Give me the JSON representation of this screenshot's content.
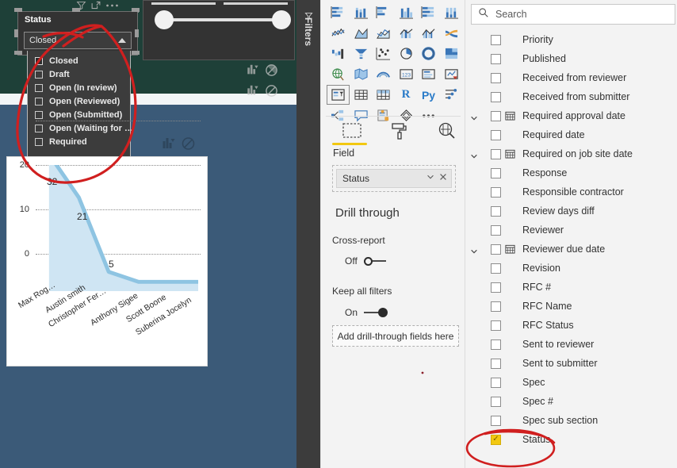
{
  "canvas": {
    "slicer": {
      "title": "Status",
      "selected_value": "Closed",
      "chevron_icon": "chevron-up-icon",
      "items": [
        {
          "label": "Closed",
          "checked": true
        },
        {
          "label": "Draft",
          "checked": false
        },
        {
          "label": "Open (In review)",
          "checked": false
        },
        {
          "label": "Open (Reviewed)",
          "checked": false
        },
        {
          "label": "Open (Submitted)",
          "checked": false
        },
        {
          "label": "Open (Waiting for …",
          "checked": false
        },
        {
          "label": "Required",
          "checked": false
        }
      ]
    },
    "range_slicer": {
      "left_knob_label": "",
      "right_knob_label": ""
    },
    "visual_header_icons": [
      "filter-icon",
      "focus-mode-icon",
      "more-options-icon"
    ],
    "visual_corner_icons": [
      "drill-down-icon",
      "no-entry-icon"
    ]
  },
  "chart_data": {
    "type": "area",
    "title": "",
    "xlabel": "",
    "ylabel": "",
    "categories": [
      "Max Rog…",
      "Austin smith",
      "Christopher Fer…",
      "Anthony Sigee",
      "Scott Boone",
      "Suberina Jocelyn"
    ],
    "values": [
      32,
      21,
      5,
      1,
      1,
      1
    ],
    "data_labels": [
      "32",
      "21",
      "5",
      "",
      "",
      ""
    ],
    "ylim": [
      0,
      30
    ],
    "yticks": [
      "0",
      "10",
      "20"
    ],
    "grid": true,
    "legend": "none",
    "series_color": "#8ec4e2",
    "fill_color": "#cfe5f3"
  },
  "viz_pane": {
    "filters_tab_label": "Filters",
    "filters_tab_icon": "filter-arrow-icon",
    "gallery_icons": [
      "stacked-bar-chart-icon",
      "stacked-column-chart-icon",
      "clustered-bar-chart-icon",
      "clustered-column-chart-icon",
      "100-stacked-bar-chart-icon",
      "100-stacked-column-chart-icon",
      "line-chart-icon",
      "area-chart-icon",
      "stacked-area-chart-icon",
      "line-stacked-column-chart-icon",
      "line-clustered-column-chart-icon",
      "ribbon-chart-icon",
      "waterfall-chart-icon",
      "funnel-chart-icon",
      "scatter-chart-icon",
      "pie-chart-icon",
      "donut-chart-icon",
      "treemap-icon",
      "map-icon",
      "filled-map-icon",
      "arcgis-map-icon",
      "card-icon",
      "multi-row-card-icon",
      "kpi-icon",
      "slicer-icon",
      "table-icon",
      "matrix-icon",
      "r-script-visual-icon",
      "python-visual-icon",
      "key-influencers-icon",
      "decomposition-tree-icon",
      "qa-visual-icon",
      "paginated-report-icon",
      "power-apps-icon",
      "more-visuals-icon"
    ],
    "tabs": [
      {
        "name": "fields-tab",
        "icon": "fields-icon",
        "active": true
      },
      {
        "name": "format-tab",
        "icon": "paint-roller-icon",
        "active": false
      },
      {
        "name": "analytics-tab",
        "icon": "magnifier-analytics-icon",
        "active": false
      }
    ],
    "field_section_label": "Field",
    "field_well_value": "Status",
    "field_well_chevron_icon": "chevron-down-icon",
    "field_well_remove_icon": "close-icon",
    "drill_through": {
      "title": "Drill through",
      "cross_report_label": "Cross-report",
      "cross_report_state": "Off",
      "keep_all_filters_label": "Keep all filters",
      "keep_all_filters_state": "On",
      "dropzone_label": "Add drill-through fields here"
    },
    "accent_color": "#f2c811"
  },
  "fields_pane": {
    "search_placeholder": "Search",
    "search_icon": "search-icon",
    "items": [
      {
        "label": "Priority",
        "checked": false,
        "expandable": false,
        "date": false
      },
      {
        "label": "Published",
        "checked": false,
        "expandable": false,
        "date": false
      },
      {
        "label": "Received from reviewer",
        "checked": false,
        "expandable": false,
        "date": false
      },
      {
        "label": "Received from submitter",
        "checked": false,
        "expandable": false,
        "date": false
      },
      {
        "label": "Required approval date",
        "checked": false,
        "expandable": true,
        "date": true
      },
      {
        "label": "Required date",
        "checked": false,
        "expandable": false,
        "date": false
      },
      {
        "label": "Required on job site date",
        "checked": false,
        "expandable": true,
        "date": true
      },
      {
        "label": "Response",
        "checked": false,
        "expandable": false,
        "date": false
      },
      {
        "label": "Responsible contractor",
        "checked": false,
        "expandable": false,
        "date": false
      },
      {
        "label": "Review days diff",
        "checked": false,
        "expandable": false,
        "date": false
      },
      {
        "label": "Reviewer",
        "checked": false,
        "expandable": false,
        "date": false
      },
      {
        "label": "Reviewer due date",
        "checked": false,
        "expandable": true,
        "date": true
      },
      {
        "label": "Revision",
        "checked": false,
        "expandable": false,
        "date": false
      },
      {
        "label": "RFC #",
        "checked": false,
        "expandable": false,
        "date": false
      },
      {
        "label": "RFC Name",
        "checked": false,
        "expandable": false,
        "date": false
      },
      {
        "label": "RFC Status",
        "checked": false,
        "expandable": false,
        "date": false
      },
      {
        "label": "Sent to reviewer",
        "checked": false,
        "expandable": false,
        "date": false
      },
      {
        "label": "Sent to submitter",
        "checked": false,
        "expandable": false,
        "date": false
      },
      {
        "label": "Spec",
        "checked": false,
        "expandable": false,
        "date": false
      },
      {
        "label": "Spec #",
        "checked": false,
        "expandable": false,
        "date": false
      },
      {
        "label": "Spec sub section",
        "checked": false,
        "expandable": false,
        "date": false
      },
      {
        "label": "Status",
        "checked": true,
        "expandable": false,
        "date": false
      }
    ]
  },
  "annotations": {
    "ink_color": "#d01f1f",
    "marks": [
      "circle-around-status-slicer",
      "circle-around-status-field"
    ]
  }
}
